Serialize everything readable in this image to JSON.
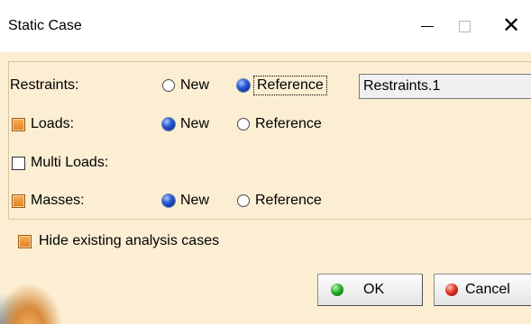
{
  "window": {
    "title": "Static Case",
    "minimize_icon": "minimize-icon",
    "maximize_icon": "maximize-icon",
    "close_icon": "close-icon",
    "close_glyph": "✕"
  },
  "rows": {
    "restraints": {
      "label": "Restraints:",
      "options": [
        "New",
        "Reference"
      ],
      "selected": "Reference",
      "value": "Restraints.1"
    },
    "loads": {
      "label": "Loads:",
      "checked": true,
      "options": [
        "New",
        "Reference"
      ],
      "selected": "New"
    },
    "multi_loads": {
      "label": "Multi Loads:",
      "checked": false
    },
    "masses": {
      "label": "Masses:",
      "checked": true,
      "options": [
        "New",
        "Reference"
      ],
      "selected": "New"
    }
  },
  "hide_existing": {
    "label": "Hide existing analysis cases",
    "checked": true
  },
  "buttons": {
    "ok": "OK",
    "cancel": "Cancel"
  },
  "colors": {
    "dialog_bg": "#fbeed3",
    "checkbox_on": "#e07f1c",
    "radio_selected": "#2a5bd7",
    "ok_icon": "#29b129",
    "cancel_icon": "#e23a2a"
  }
}
